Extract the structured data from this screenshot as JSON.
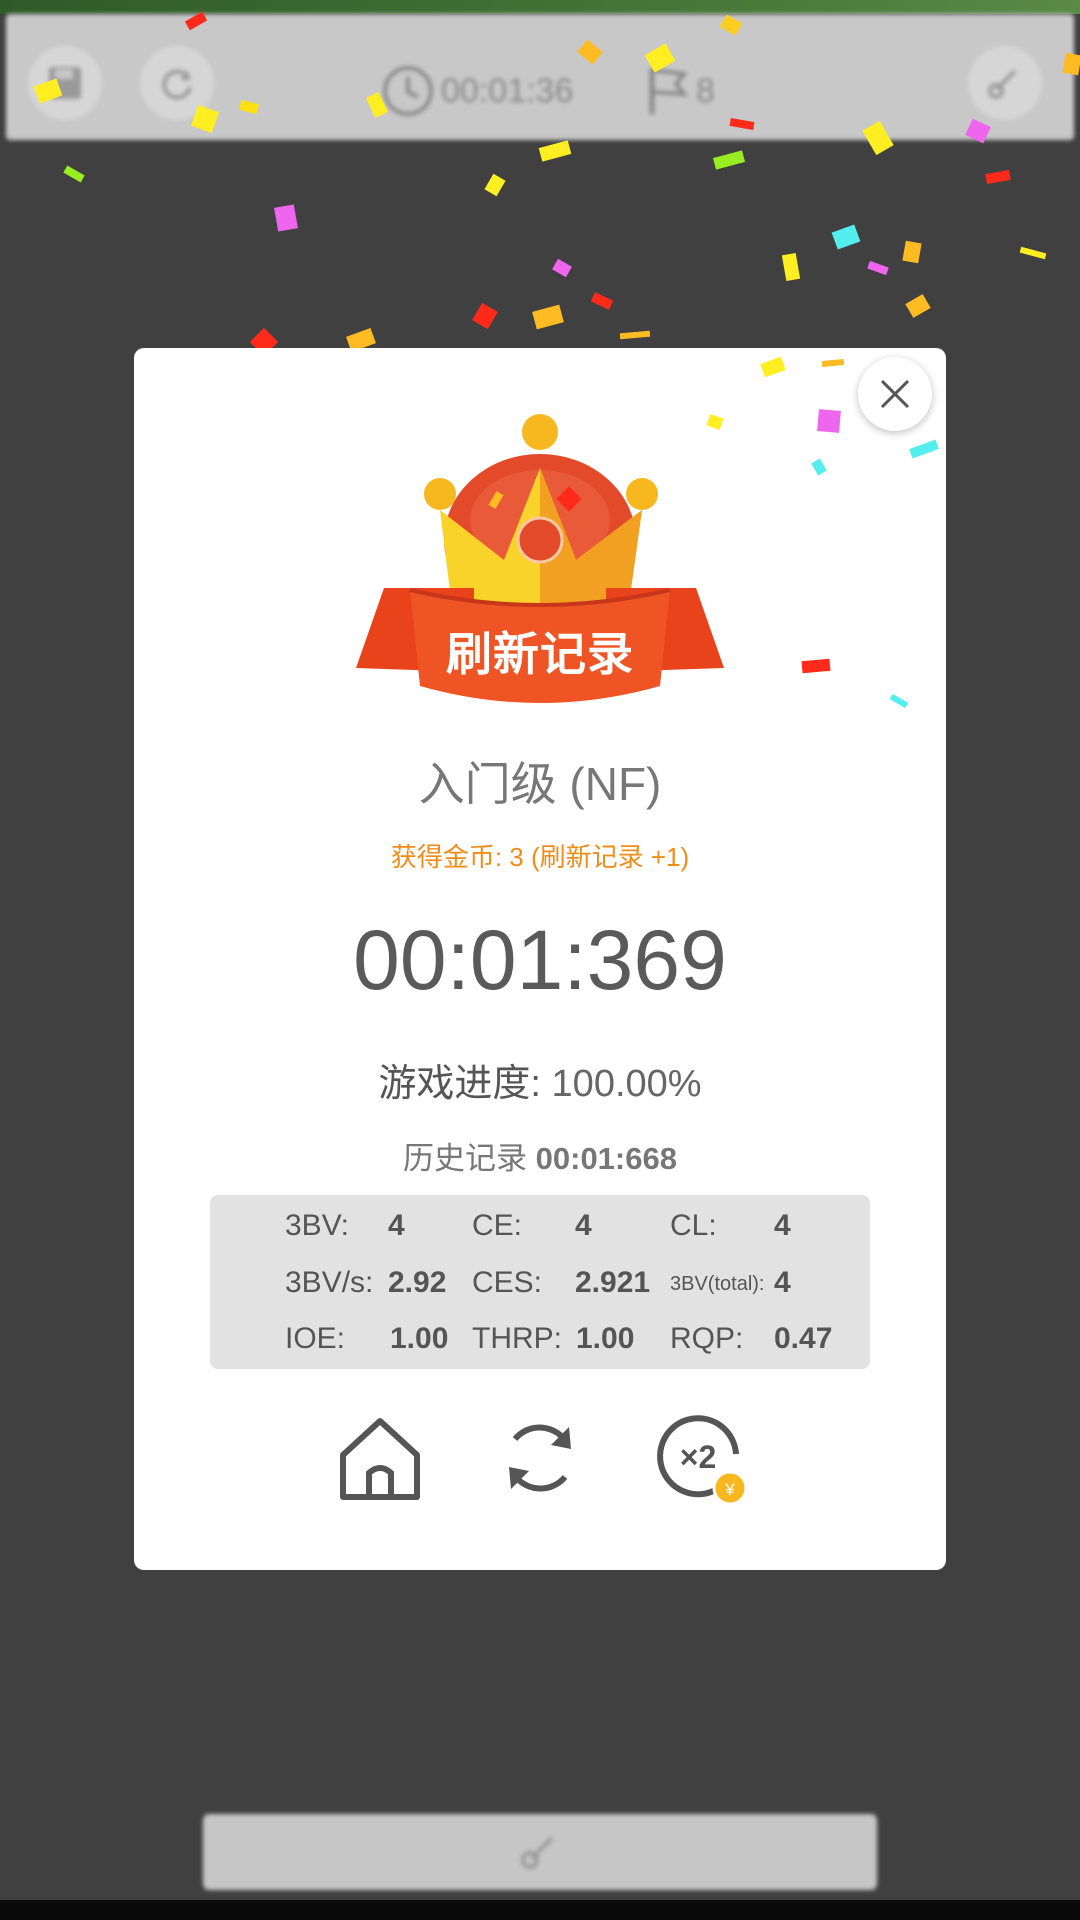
{
  "topbar": {
    "time": "00:01:36",
    "flags": "8"
  },
  "dialog": {
    "banner": "刷新记录",
    "level": "入门级 (NF)",
    "coins": "获得金币: 3 (刷新记录 +1)",
    "time": "00:01:369",
    "progress_label": "游戏进度:",
    "progress_value": "100.00%",
    "history_label": "历史记录",
    "history_value": "00:01:668"
  },
  "stats": {
    "bbbv_label": "3BV:",
    "bbbv": "4",
    "ce_label": "CE:",
    "ce": "4",
    "cl_label": "CL:",
    "cl": "4",
    "bbbvs_label": "3BV/s:",
    "bbbvs": "2.92",
    "ces_label": "CES:",
    "ces": "2.921",
    "bbbvtotal_label": "3BV(total):",
    "bbbvtotal": "4",
    "ioe_label": "IOE:",
    "ioe": "1.00",
    "thrp_label": "THRP:",
    "thrp": "1.00",
    "rqp_label": "RQP:",
    "rqp": "0.47"
  },
  "actions": {
    "home_icon": "home-icon",
    "restart_icon": "restart-icon",
    "double_icon": "double-coins-icon",
    "double_badge": "x2",
    "coin_symbol": "¥"
  },
  "colors": {
    "accent_orange": "#f08c1a",
    "banner_red": "#e8431b",
    "crown_gold": "#f7b81f"
  }
}
